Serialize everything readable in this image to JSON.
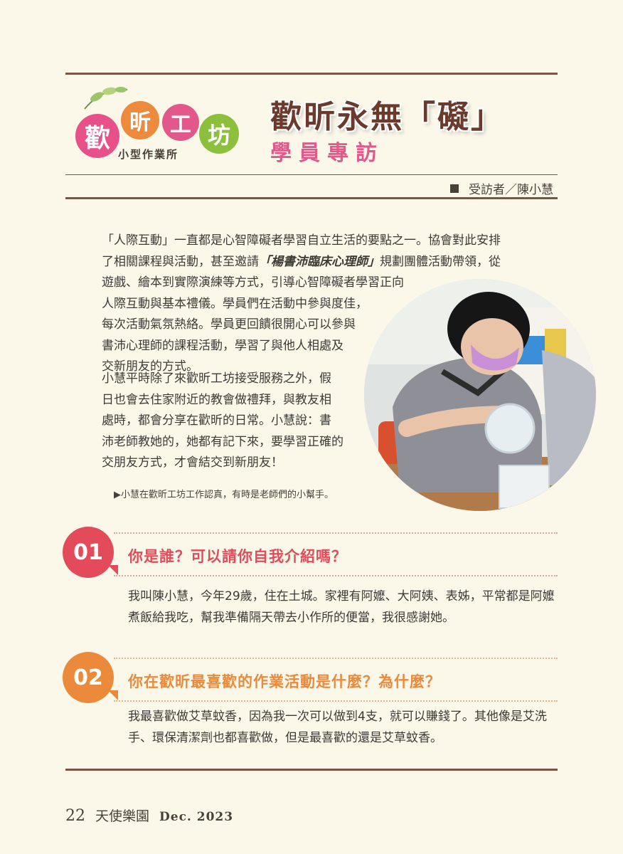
{
  "header": {
    "logo": {
      "chars": [
        "歡",
        "昕",
        "工",
        "坊"
      ],
      "subtitle": "小型作業所",
      "colors": [
        "#e8508a",
        "#ee8a3c",
        "#e2588b",
        "#8bbf3c"
      ]
    },
    "title": "歡昕永無「礙」",
    "subtitle": "學員專訪",
    "interviewee": "受訪者／陳小慧"
  },
  "intro": {
    "para1_a": "「人際互動」一直都是心智障礙者學習自立生活的要點之一。協會對此安排",
    "para1_b": "了相關課程與活動，甚至邀請",
    "para1_em": "「楊書沛臨床心理師」",
    "para1_c": "規劃團體活動帶領，從",
    "para1_lines": [
      "遊戲、繪本到實際演練等方式，引導心智障礙者學習正向",
      "人際互動與基本禮儀。學員們在活動中參與度佳，",
      "每次活動氣氛熱絡。學員更回饋很開心可以參與",
      "書沛心理師的課程活動，學習了與他人相處及",
      "交新朋友的方式。"
    ],
    "para2_lines": [
      "小慧平時除了來歡昕工坊接受服務之外，假",
      "日也會去住家附近的教會做禮拜，與教友相",
      "處時，都會分享在歡昕的日常。小慧說：書",
      "沛老師教她的，她都有記下來，要學習正確的",
      "交朋友方式，才會結交到新朋友！"
    ]
  },
  "caption": "▶小慧在歡昕工坊工作認真，有時是老師們的小幫手。",
  "qa": [
    {
      "number": "01",
      "color": "#e34a5a",
      "question": "你是誰？可以請你自我介紹嗎？",
      "answer": "我叫陳小慧，今年29歲，住在土城。家裡有阿嬤、大阿姨、表姊，平常都是阿嬤煮飯給我吃，幫我準備隔天帶去小作所的便當，我很感謝她。"
    },
    {
      "number": "02",
      "color": "#ea8a3a",
      "question": "你在歡昕最喜歡的作業活動是什麼？為什麼？",
      "answer": "我最喜歡做艾草蚊香，因為我一次可以做到4支，就可以賺錢了。其他像是艾洗手、環保清潔劑也都喜歡做，但是最喜歡的還是艾草蚊香。"
    }
  ],
  "footer": {
    "page": "22",
    "magazine": "天使樂園",
    "date": "Dec. 2023"
  }
}
